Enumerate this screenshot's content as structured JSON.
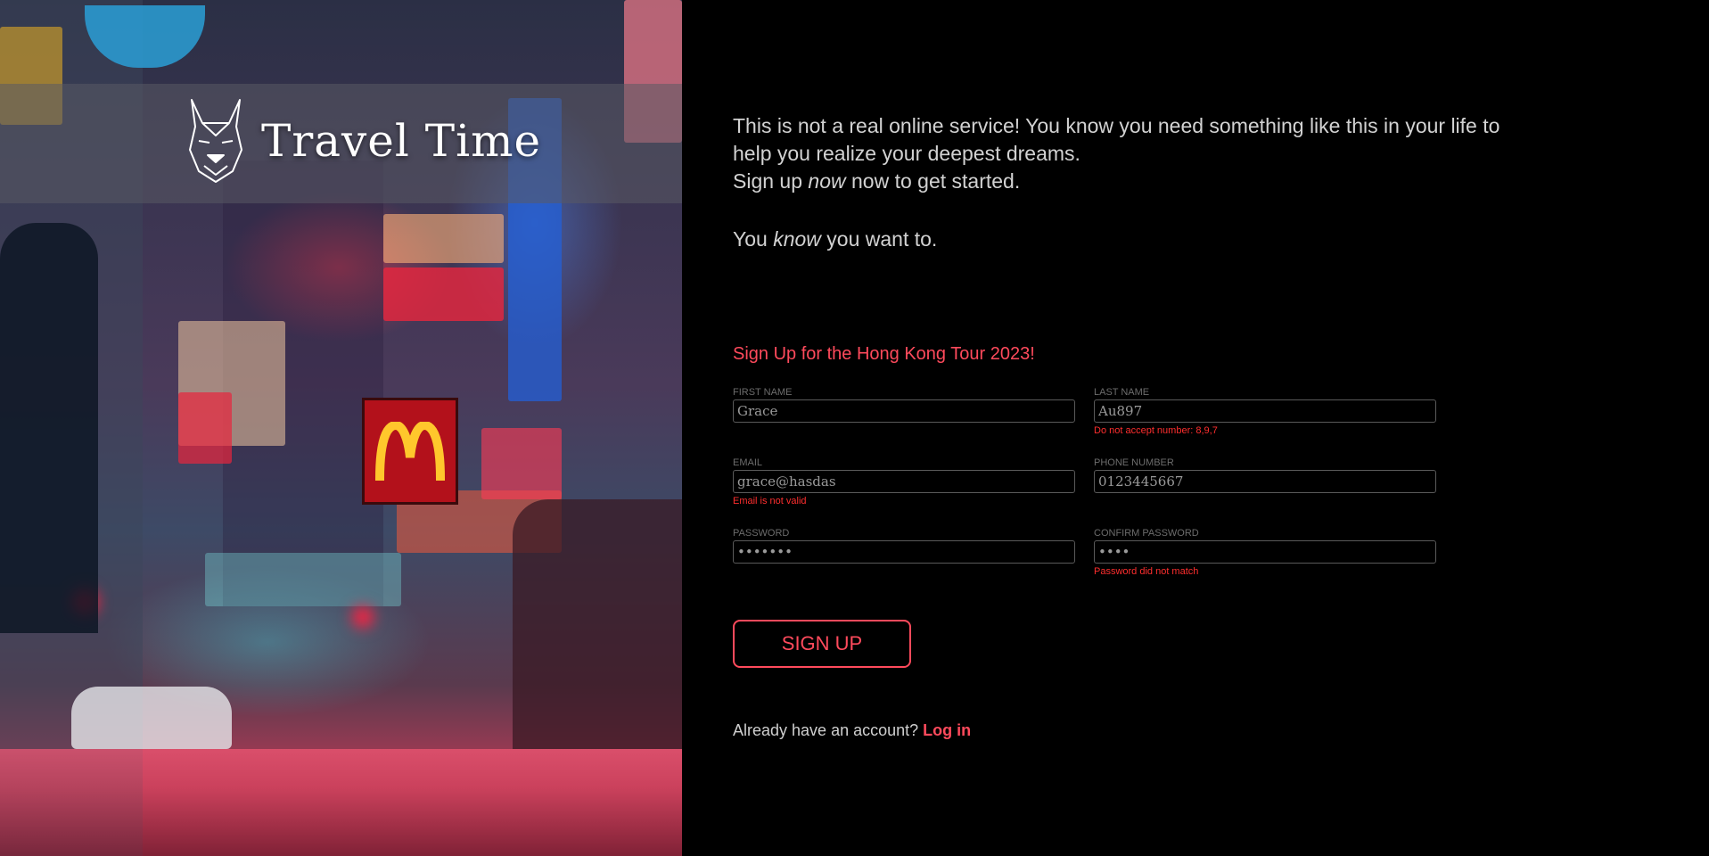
{
  "brand": {
    "name": "Travel Time",
    "logo_icon": "dog-head-icon"
  },
  "hero": {
    "arch_letter": "M"
  },
  "intro": {
    "line1": "This is not a real online service! You know you need something like this in your life to help you realize your deepest dreams.",
    "line2_pre": "Sign up ",
    "line2_em": "now",
    "line2_post": " now to get started.",
    "line3_pre": "You ",
    "line3_em": "know",
    "line3_post": " you want to."
  },
  "form": {
    "title": "Sign Up for the  Hong  Kong Tour 2023!",
    "first_name": {
      "label": "First Name",
      "value": "Grace",
      "error": ""
    },
    "last_name": {
      "label": "Last Name",
      "value": "Au897",
      "error": "Do not accept number: 8,9,7"
    },
    "email": {
      "label": "Email",
      "value": "grace@hasdas",
      "error": "Email is not valid"
    },
    "phone": {
      "label": "Phone Number",
      "value": "0123445667",
      "error": ""
    },
    "password": {
      "label": "Password",
      "value": "•••••••",
      "error": ""
    },
    "confirm_password": {
      "label": "Confirm Password",
      "value": "••••",
      "error": "Password did not match"
    },
    "submit_label": "SIGN UP"
  },
  "login": {
    "prompt": "Already have an account? ",
    "link": "Log in"
  },
  "colors": {
    "accent": "#ff4a5c",
    "error": "#ff2e2e",
    "background": "#000000"
  }
}
